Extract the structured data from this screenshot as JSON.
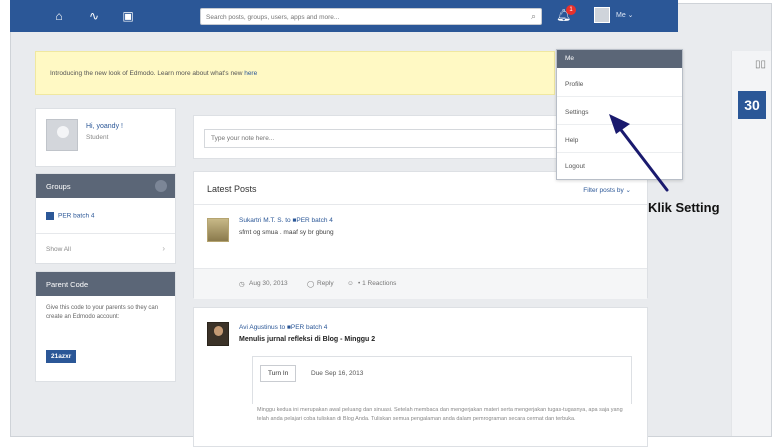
{
  "search": {
    "placeholder": "Search posts, groups, users, apps and more..."
  },
  "topbar": {
    "notification_count": "1",
    "me_label": "Me ⌄"
  },
  "banner": {
    "text": "Introducing the new look of Edmodo. Learn more about what's new ",
    "link": "here"
  },
  "profile": {
    "name": "Hi, yoandy !",
    "role": "Student"
  },
  "groups": {
    "title": "Groups",
    "items": [
      {
        "label": "PER batch 4"
      }
    ],
    "show_all": "Show All"
  },
  "parent_code": {
    "title": "Parent Code",
    "text": "Give this code to your parents so they can create an Edmodo account:",
    "code": "21azxr"
  },
  "composer": {
    "placeholder": "Type your note here..."
  },
  "feed": {
    "title": "Latest Posts",
    "filter": "Filter posts by ⌄",
    "post1": {
      "author": "Sukartri M.T. S.  to  ■PER batch 4",
      "text": "sfmt og smua . maaf sy br gbung",
      "date": "Aug 30, 2013",
      "reply": "Reply",
      "reactions": "•  1 Reactions"
    },
    "post2": {
      "author": "Avi Agustinus  to  ■PER batch 4",
      "title": "Menulis jurnal refleksi di Blog - Minggu 2",
      "turn_in": "Turn In",
      "due": "Due Sep 16, 2013",
      "body": "Minggu kedua ini merupakan awal peluang dan sinuasi. Setelah membaca dan mengerjakan materi serta mengerjakan tugas-tugasnya, apa saja yang telah anda pelajari coba tuliskan di Blog Anda. Tuliskan semua pengalaman anda dalam pemrograman secara cermat dan terbuka."
    }
  },
  "dropdown": {
    "header": "Me",
    "items": [
      "Profile",
      "Settings",
      "Help",
      "Logout"
    ]
  },
  "rail": {
    "calendar_day": "30"
  },
  "callout": {
    "label": "Klik Setting"
  },
  "colors": {
    "brand": "#2b5797",
    "sidebar_header": "#5b6677",
    "banner": "#fff9c4"
  }
}
